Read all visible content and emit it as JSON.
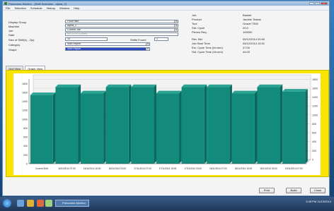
{
  "window": {
    "title": "Panorama Monitor - [Shift Selection : alpha_2]"
  },
  "menu": [
    "File",
    "Selection",
    "Schedule",
    "History",
    "Window",
    "Help"
  ],
  "form": {
    "fields": [
      {
        "label": "Display Group",
        "value": "FloorPlant"
      },
      {
        "label": "Machine",
        "value": "Alpha_2"
      },
      {
        "label": "Job",
        "value": "Current Job"
      },
      {
        "label": "Date",
        "value": "05/12/2014 (Mon)"
      }
    ],
    "size_label": "Size of Shift(s) - 2(s)",
    "size_value": "10",
    "shifts_found_label": "Shifts Found",
    "shifts_found_value": "1",
    "category_label": "Category",
    "category_value": "Shift Report",
    "shape_label": "Shape",
    "shape_value": "Shift Report"
  },
  "info": [
    {
      "label": "Job",
      "value": "Basket"
    },
    {
      "label": "Product",
      "value": "Jacobs' Sweat"
    },
    {
      "label": "Tool",
      "value": "Gravel T300"
    },
    {
      "label": "Std. Cycle",
      "value": "20.0"
    },
    {
      "label": "Pieces Req.",
      "value": "100000"
    },
    {
      "label": "Rev. Bkl",
      "value": "05/12/2014 00:00"
    },
    {
      "label": "Job Start Time",
      "value": "05/12/2014 15:31"
    },
    {
      "label": "Est. Cycle Time (hh:mm)",
      "value": "37:00"
    },
    {
      "label": "Std. Cycle Time (hh:mm)",
      "value": "44:00"
    }
  ],
  "tabs": [
    "Grid View",
    "Graph View"
  ],
  "chart_data": {
    "type": "bar",
    "categories": [
      "Current Shift",
      "16/11/2014 07:00",
      "16/11/2014 15:00",
      "16/11/2014 23:00",
      "17/11/2014 07:00",
      "17/11/2014 15:00",
      "17/11/2014 23:00",
      "18/11/2014 07:00",
      "18/11/2014 15:00",
      "18/11/2014 23:00",
      "19/11/2014 07:00"
    ],
    "values": [
      1540,
      1720,
      1580,
      1720,
      1720,
      1580,
      1720,
      1720,
      1580,
      1720,
      1620
    ],
    "y_ticks": [
      "0",
      "200",
      "400",
      "600",
      "800",
      "1000",
      "1200",
      "1400",
      "1600",
      "1800"
    ],
    "ylim": [
      0,
      1900
    ],
    "bar_color": "#128a7c",
    "grid": true
  },
  "buttons": {
    "print": "Print",
    "build": "Build",
    "close": "Close"
  },
  "taskbar": {
    "app_label": "Panorama Monitor",
    "clock": "3:45 PM 11/19/2014"
  }
}
